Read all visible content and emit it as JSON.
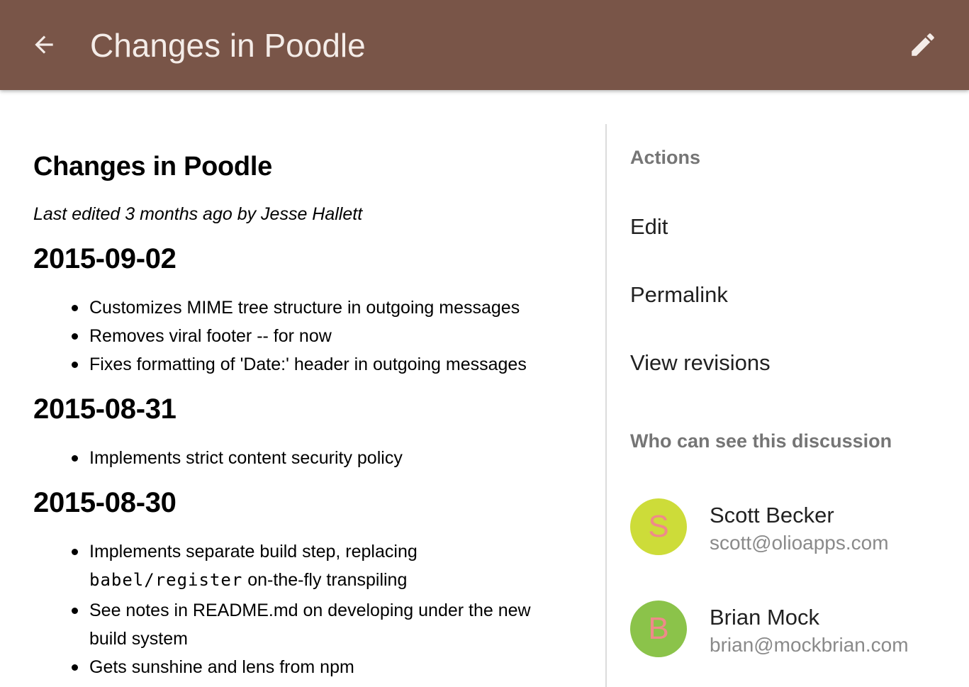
{
  "appbar": {
    "title": "Changes in Poodle",
    "back_icon": "arrow-back-icon",
    "edit_icon": "pencil-icon",
    "bg_color": "#795548"
  },
  "document": {
    "title": "Changes in Poodle",
    "meta": "Last edited 3 months ago by Jesse Hallett",
    "sections": [
      {
        "date": "2015-09-02",
        "items": [
          "Customizes MIME tree structure in outgoing messages",
          "Removes viral footer -- for now",
          "Fixes formatting of 'Date:' header in outgoing messages"
        ]
      },
      {
        "date": "2015-08-31",
        "items": [
          "Implements strict content security policy"
        ]
      },
      {
        "date": "2015-08-30",
        "items": [
          {
            "before": "Implements separate build step, replacing",
            "code": "babel/register",
            "after": "on-the-fly transpiling"
          },
          "See notes in README.md on developing under the new build system",
          "Gets sunshine and lens from npm"
        ]
      }
    ]
  },
  "sidebar": {
    "actions_label": "Actions",
    "actions": [
      "Edit",
      "Permalink",
      "View revisions"
    ],
    "visibility_label": "Who can see this discussion",
    "people": [
      {
        "initial": "S",
        "name": "Scott Becker",
        "email": "scott@olioapps.com",
        "avatar_color": "#cddc39"
      },
      {
        "initial": "B",
        "name": "Brian Mock",
        "email": "brian@mockbrian.com",
        "avatar_color": "#8bc34a"
      }
    ]
  }
}
